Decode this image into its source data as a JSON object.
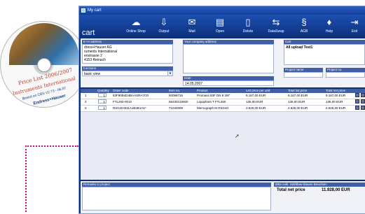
{
  "window": {
    "title": "My cart"
  },
  "toolbar": {
    "title": "cart",
    "items": [
      {
        "label": "Online Shop",
        "icon": "online-shop-icon",
        "glyph": "☁"
      },
      {
        "label": "Output",
        "icon": "output-icon",
        "glyph": "⇩"
      },
      {
        "label": "Mail",
        "icon": "mail-icon",
        "glyph": "✉"
      },
      {
        "label": "Open",
        "icon": "open-icon",
        "glyph": "▤"
      },
      {
        "label": "Delete",
        "icon": "delete-icon",
        "glyph": "▯"
      },
      {
        "label": "DataSwap",
        "icon": "dataswap-icon",
        "glyph": "⇆"
      },
      {
        "label": "AGB",
        "icon": "agb-icon",
        "glyph": "§"
      },
      {
        "label": "Help",
        "icon": "help-icon",
        "glyph": "♦"
      },
      {
        "label": "Exit",
        "icon": "exit-icon",
        "glyph": "⇥"
      }
    ]
  },
  "form": {
    "e_address_label": "E+H address",
    "e_address_lines": [
      "dress+Hauser AG",
      "ruments International",
      "enstrasse 2",
      "4153 Reinach"
    ],
    "your_address_label": "Your company address",
    "cart_label": "Cart",
    "cart_value": "All upload Test1",
    "functions_label": "functions",
    "functions_value": "basic view",
    "date_label": "Date",
    "date_value": "14.05.2007",
    "project_name_label": "Project name",
    "project_no_label": "Project no."
  },
  "grid": {
    "headers": [
      "Quantity",
      "Order code",
      "Item no.",
      "Product",
      "List price per unit",
      "Total list price",
      "Total net price"
    ],
    "rows": [
      {
        "pos": "1",
        "qty": "1",
        "code": "83F80B4D4BAASRA7CR",
        "item": "50096726",
        "product": "Promass 83F DN 8 3/8\"",
        "list_unit": "9.167,00 EUR",
        "list_total": "9.167,00 EUR",
        "net_total": "9.167,00 EUR"
      },
      {
        "pos": "2",
        "qty": "1",
        "code": "FTL260-0010",
        "item": "56230219000",
        "product": "Liquiphant T FTL260",
        "list_unit": "136,00 EUR",
        "list_total": "136,00 EUR",
        "net_total": "136,00 EUR"
      },
      {
        "pos": "3",
        "qty": "1",
        "code": "RSG40-B11A1B2B1A1*",
        "item": "71040099",
        "product": "Memograph M RSG40",
        "list_unit": "2.625,00 EUR",
        "list_total": "2.625,00 EUR",
        "net_total": "2.625,00 EUR"
      }
    ]
  },
  "bottom": {
    "remarks_label": "Remarks to project",
    "summary_header": "Bitte exkl. Stahlbau-blauen Beachten",
    "total_label": "Total net price",
    "total_value": "11.928,00 EUR"
  },
  "cd": {
    "title": "Price List 2006/2007",
    "subtitle": "Instruments International",
    "basis": "Based on CBS V2.73 - 06.07",
    "brand": "Endress+Hauser"
  }
}
